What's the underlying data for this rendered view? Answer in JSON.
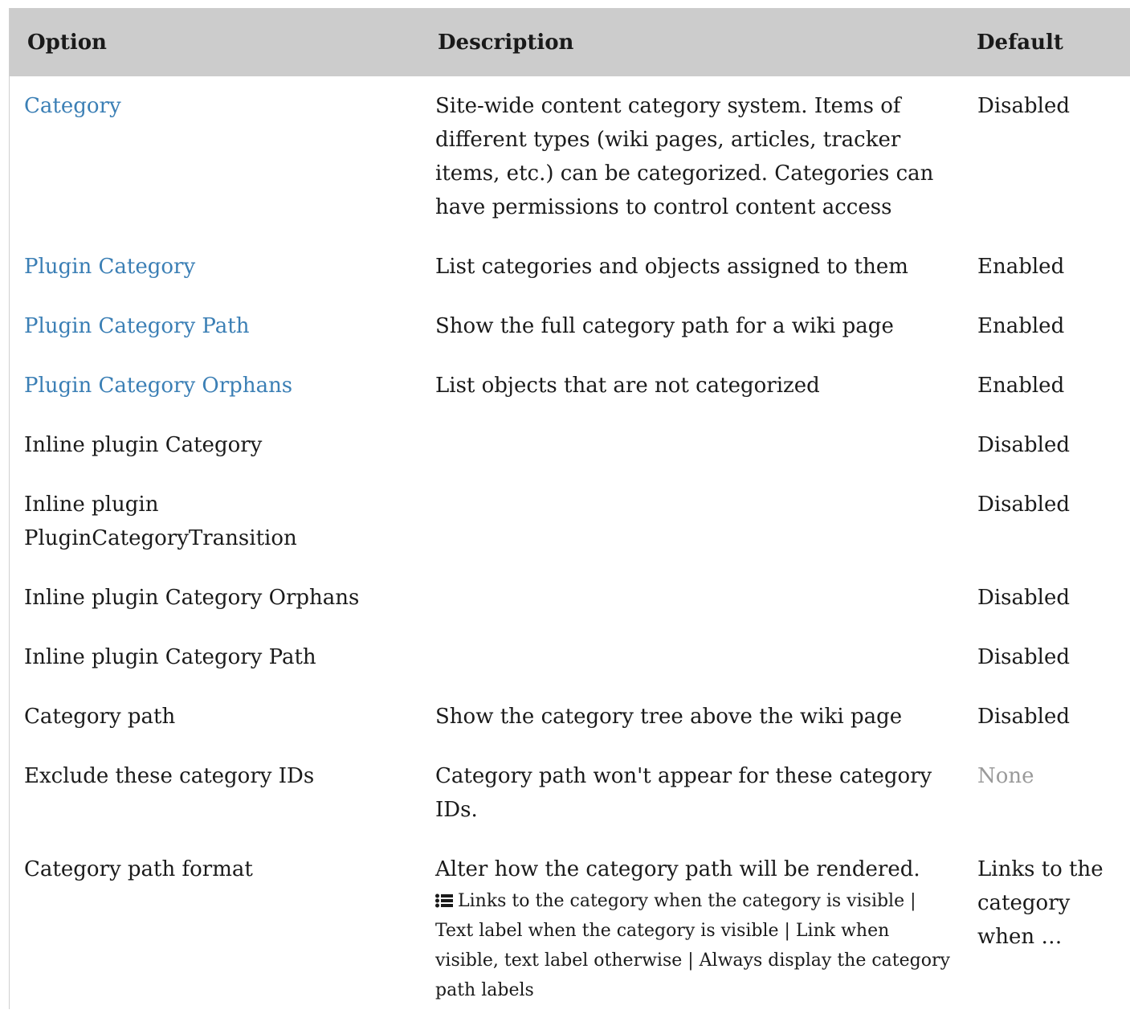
{
  "table": {
    "headers": {
      "option": "Option",
      "description": "Description",
      "default": "Default"
    },
    "rows": [
      {
        "option": "Category",
        "option_is_link": true,
        "description": "Site-wide content category system. Items of different types (wiki pages, articles, tracker items, etc.) can be categorized. Categories can have permissions to control content access",
        "default": "Disabled"
      },
      {
        "option": "Plugin Category",
        "option_is_link": true,
        "description": "List categories and objects assigned to them",
        "default": "Enabled"
      },
      {
        "option": "Plugin Category Path",
        "option_is_link": true,
        "description": "Show the full category path for a wiki page",
        "default": "Enabled"
      },
      {
        "option": "Plugin Category Orphans",
        "option_is_link": true,
        "description": "List objects that are not categorized",
        "default": "Enabled"
      },
      {
        "option": "Inline plugin Category",
        "option_is_link": false,
        "description": "",
        "default": "Disabled"
      },
      {
        "option": "Inline plugin PluginCategoryTransition",
        "option_is_link": false,
        "description": "",
        "default": "Disabled"
      },
      {
        "option": "Inline plugin Category Orphans",
        "option_is_link": false,
        "description": "",
        "default": "Disabled"
      },
      {
        "option": "Inline plugin Category Path",
        "option_is_link": false,
        "description": "",
        "default": "Disabled"
      },
      {
        "option": "Category path",
        "option_is_link": false,
        "description": "Show the category tree above the wiki page",
        "default": "Disabled"
      },
      {
        "option": "Exclude these category IDs",
        "option_is_link": false,
        "description": "Category path won't appear for these category IDs.",
        "default": "None",
        "default_muted": true
      },
      {
        "option": "Category path format",
        "option_is_link": false,
        "description": "Alter how the category path will be rendered.",
        "description_options_icon": "list-icon",
        "description_options": "Links to the category when the category is visible | Text label when the category is visible | Link when visible, text label otherwise | Always display the category path labels",
        "default": "Links to the category when …"
      }
    ]
  },
  "colors": {
    "header_bg": "#cccccc",
    "link": "#3b7fb5",
    "muted": "#9a9a9a",
    "text": "#1a1a1a"
  }
}
